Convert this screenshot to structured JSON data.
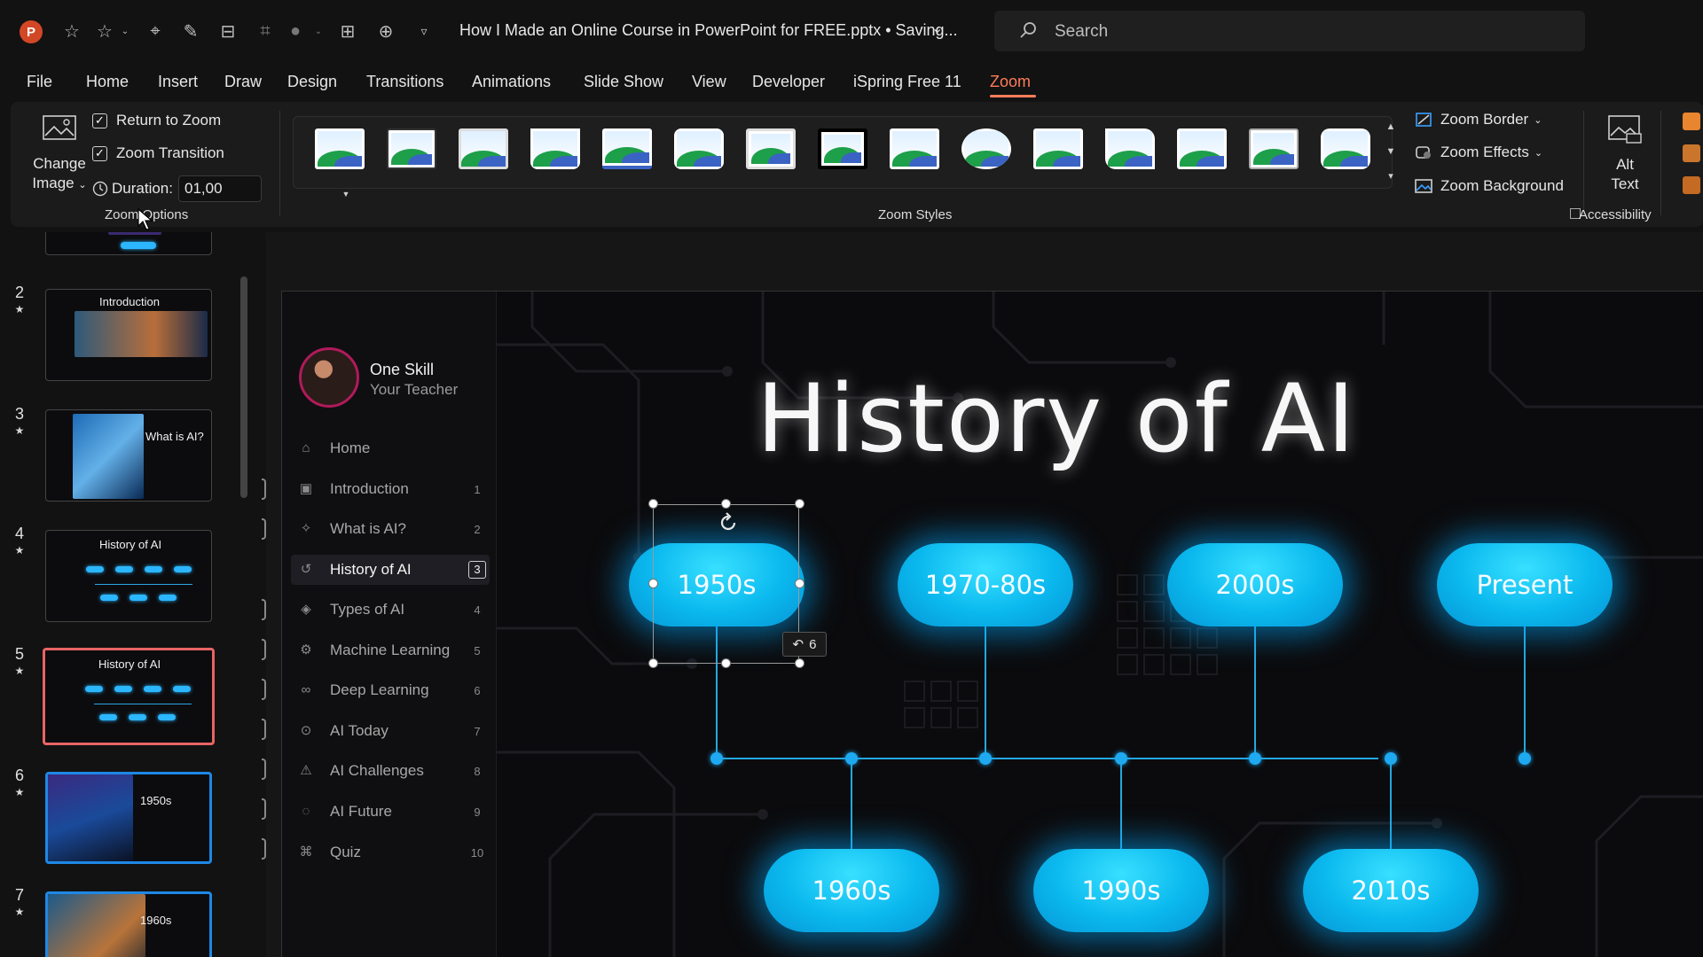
{
  "titlebar": {
    "app_logo": "P",
    "doc_title": "How I Made an Online Course in PowerPoint for FREE.pptx • Saving...",
    "search_placeholder": "Search",
    "quick_access_icons": [
      "autosave-star-icon",
      "star-icon",
      "move-icon",
      "magic-icon",
      "align-icon",
      "crop-icon",
      "shape-fill-icon",
      "distribute-icon",
      "center-icon",
      "customize-qat-icon"
    ]
  },
  "menu": {
    "tabs": [
      "File",
      "Home",
      "Insert",
      "Draw",
      "Design",
      "Transitions",
      "Animations",
      "Slide Show",
      "View",
      "Developer",
      "iSpring Free 11",
      "Zoom"
    ],
    "active_tab": "Zoom"
  },
  "ribbon": {
    "change_image_line1": "Change",
    "change_image_line2": "Image",
    "return_to_zoom": "Return to Zoom",
    "return_to_zoom_checked": true,
    "zoom_transition": "Zoom Transition",
    "zoom_transition_checked": true,
    "duration_label": "Duration:",
    "duration_value": "01,00",
    "zoom_options_label": "Zoom Options",
    "zoom_styles_label": "Zoom Styles",
    "zoom_border": "Zoom Border",
    "zoom_effects": "Zoom Effects",
    "zoom_background": "Zoom Background",
    "alt_text_line1": "Alt",
    "alt_text_line2": "Text",
    "accessibility_label": "Accessibility",
    "style_count": 15
  },
  "slides_panel": {
    "slides": [
      {
        "num": "2",
        "title": "Introduction"
      },
      {
        "num": "3",
        "title": "What is AI?"
      },
      {
        "num": "4",
        "title": "History of AI"
      },
      {
        "num": "5",
        "title": "History of AI",
        "selected": true
      },
      {
        "num": "6",
        "title": "1950s"
      },
      {
        "num": "7",
        "title": "1960s"
      }
    ]
  },
  "slide": {
    "teacher_name": "One Skill",
    "teacher_role": "Your Teacher",
    "nav": [
      {
        "label": "Home",
        "num": "",
        "icon": "home-icon"
      },
      {
        "label": "Introduction",
        "num": "1",
        "icon": "image-icon"
      },
      {
        "label": "What is AI?",
        "num": "2",
        "icon": "sparkle-icon"
      },
      {
        "label": "History of AI",
        "num": "3",
        "icon": "history-icon",
        "active": true
      },
      {
        "label": "Types of AI",
        "num": "4",
        "icon": "layers-icon"
      },
      {
        "label": "Machine Learning",
        "num": "5",
        "icon": "gear-icon"
      },
      {
        "label": "Deep Learning",
        "num": "6",
        "icon": "binoculars-icon"
      },
      {
        "label": "AI Today",
        "num": "7",
        "icon": "location-pin-icon"
      },
      {
        "label": "AI Challenges",
        "num": "8",
        "icon": "warning-icon"
      },
      {
        "label": "AI Future",
        "num": "9",
        "icon": "planet-icon"
      },
      {
        "label": "Quiz",
        "num": "10",
        "icon": "graduation-cap-icon"
      }
    ],
    "title": "History of AI",
    "timeline_top": [
      "1950s",
      "1970-80s",
      "2000s",
      "Present"
    ],
    "timeline_bottom": [
      "1960s",
      "1990s",
      "2010s"
    ],
    "return_badge": "6",
    "colors": {
      "pill": "#0ab8ee",
      "line": "#23a8e0",
      "active_tab": "#ff7d5a",
      "selected_slide": "#e86464"
    }
  }
}
